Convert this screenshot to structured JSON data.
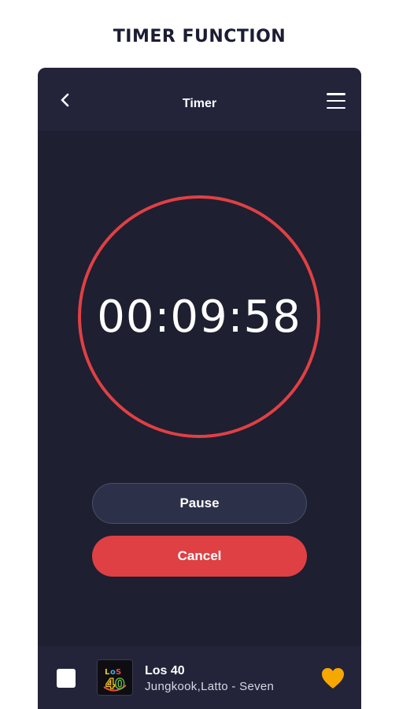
{
  "headline": "TIMER FUNCTION",
  "header": {
    "title": "Timer",
    "back_icon": "chevron-left-icon",
    "menu_icon": "hamburger-menu-icon"
  },
  "timer": {
    "display": "00:09:58"
  },
  "actions": {
    "pause_label": "Pause",
    "cancel_label": "Cancel"
  },
  "player": {
    "station": "Los 40",
    "track": "Jungkook,Latto - Seven",
    "stop_icon": "stop-icon",
    "favorite_icon": "heart-icon"
  },
  "colors": {
    "background": "#1e1f31",
    "bar": "#23243a",
    "accent_red": "#e04044",
    "heart": "#f7a800"
  }
}
